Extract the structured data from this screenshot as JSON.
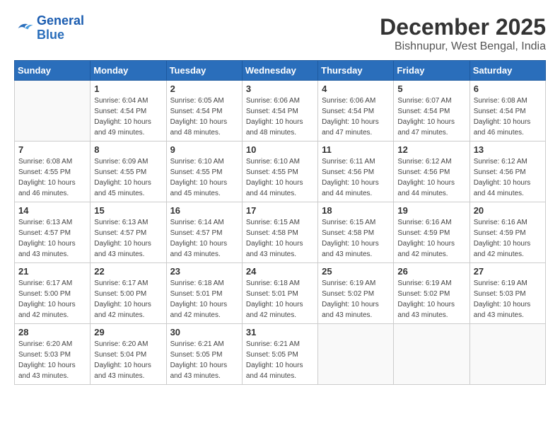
{
  "logo": {
    "line1": "General",
    "line2": "Blue"
  },
  "title": "December 2025",
  "location": "Bishnupur, West Bengal, India",
  "days_of_week": [
    "Sunday",
    "Monday",
    "Tuesday",
    "Wednesday",
    "Thursday",
    "Friday",
    "Saturday"
  ],
  "weeks": [
    [
      {
        "day": "",
        "sunrise": "",
        "sunset": "",
        "daylight": ""
      },
      {
        "day": "1",
        "sunrise": "6:04 AM",
        "sunset": "4:54 PM",
        "daylight": "10 hours and 49 minutes."
      },
      {
        "day": "2",
        "sunrise": "6:05 AM",
        "sunset": "4:54 PM",
        "daylight": "10 hours and 48 minutes."
      },
      {
        "day": "3",
        "sunrise": "6:06 AM",
        "sunset": "4:54 PM",
        "daylight": "10 hours and 48 minutes."
      },
      {
        "day": "4",
        "sunrise": "6:06 AM",
        "sunset": "4:54 PM",
        "daylight": "10 hours and 47 minutes."
      },
      {
        "day": "5",
        "sunrise": "6:07 AM",
        "sunset": "4:54 PM",
        "daylight": "10 hours and 47 minutes."
      },
      {
        "day": "6",
        "sunrise": "6:08 AM",
        "sunset": "4:54 PM",
        "daylight": "10 hours and 46 minutes."
      }
    ],
    [
      {
        "day": "7",
        "sunrise": "6:08 AM",
        "sunset": "4:55 PM",
        "daylight": "10 hours and 46 minutes."
      },
      {
        "day": "8",
        "sunrise": "6:09 AM",
        "sunset": "4:55 PM",
        "daylight": "10 hours and 45 minutes."
      },
      {
        "day": "9",
        "sunrise": "6:10 AM",
        "sunset": "4:55 PM",
        "daylight": "10 hours and 45 minutes."
      },
      {
        "day": "10",
        "sunrise": "6:10 AM",
        "sunset": "4:55 PM",
        "daylight": "10 hours and 44 minutes."
      },
      {
        "day": "11",
        "sunrise": "6:11 AM",
        "sunset": "4:56 PM",
        "daylight": "10 hours and 44 minutes."
      },
      {
        "day": "12",
        "sunrise": "6:12 AM",
        "sunset": "4:56 PM",
        "daylight": "10 hours and 44 minutes."
      },
      {
        "day": "13",
        "sunrise": "6:12 AM",
        "sunset": "4:56 PM",
        "daylight": "10 hours and 44 minutes."
      }
    ],
    [
      {
        "day": "14",
        "sunrise": "6:13 AM",
        "sunset": "4:57 PM",
        "daylight": "10 hours and 43 minutes."
      },
      {
        "day": "15",
        "sunrise": "6:13 AM",
        "sunset": "4:57 PM",
        "daylight": "10 hours and 43 minutes."
      },
      {
        "day": "16",
        "sunrise": "6:14 AM",
        "sunset": "4:57 PM",
        "daylight": "10 hours and 43 minutes."
      },
      {
        "day": "17",
        "sunrise": "6:15 AM",
        "sunset": "4:58 PM",
        "daylight": "10 hours and 43 minutes."
      },
      {
        "day": "18",
        "sunrise": "6:15 AM",
        "sunset": "4:58 PM",
        "daylight": "10 hours and 43 minutes."
      },
      {
        "day": "19",
        "sunrise": "6:16 AM",
        "sunset": "4:59 PM",
        "daylight": "10 hours and 42 minutes."
      },
      {
        "day": "20",
        "sunrise": "6:16 AM",
        "sunset": "4:59 PM",
        "daylight": "10 hours and 42 minutes."
      }
    ],
    [
      {
        "day": "21",
        "sunrise": "6:17 AM",
        "sunset": "5:00 PM",
        "daylight": "10 hours and 42 minutes."
      },
      {
        "day": "22",
        "sunrise": "6:17 AM",
        "sunset": "5:00 PM",
        "daylight": "10 hours and 42 minutes."
      },
      {
        "day": "23",
        "sunrise": "6:18 AM",
        "sunset": "5:01 PM",
        "daylight": "10 hours and 42 minutes."
      },
      {
        "day": "24",
        "sunrise": "6:18 AM",
        "sunset": "5:01 PM",
        "daylight": "10 hours and 42 minutes."
      },
      {
        "day": "25",
        "sunrise": "6:19 AM",
        "sunset": "5:02 PM",
        "daylight": "10 hours and 43 minutes."
      },
      {
        "day": "26",
        "sunrise": "6:19 AM",
        "sunset": "5:02 PM",
        "daylight": "10 hours and 43 minutes."
      },
      {
        "day": "27",
        "sunrise": "6:19 AM",
        "sunset": "5:03 PM",
        "daylight": "10 hours and 43 minutes."
      }
    ],
    [
      {
        "day": "28",
        "sunrise": "6:20 AM",
        "sunset": "5:03 PM",
        "daylight": "10 hours and 43 minutes."
      },
      {
        "day": "29",
        "sunrise": "6:20 AM",
        "sunset": "5:04 PM",
        "daylight": "10 hours and 43 minutes."
      },
      {
        "day": "30",
        "sunrise": "6:21 AM",
        "sunset": "5:05 PM",
        "daylight": "10 hours and 43 minutes."
      },
      {
        "day": "31",
        "sunrise": "6:21 AM",
        "sunset": "5:05 PM",
        "daylight": "10 hours and 44 minutes."
      },
      {
        "day": "",
        "sunrise": "",
        "sunset": "",
        "daylight": ""
      },
      {
        "day": "",
        "sunrise": "",
        "sunset": "",
        "daylight": ""
      },
      {
        "day": "",
        "sunrise": "",
        "sunset": "",
        "daylight": ""
      }
    ]
  ]
}
